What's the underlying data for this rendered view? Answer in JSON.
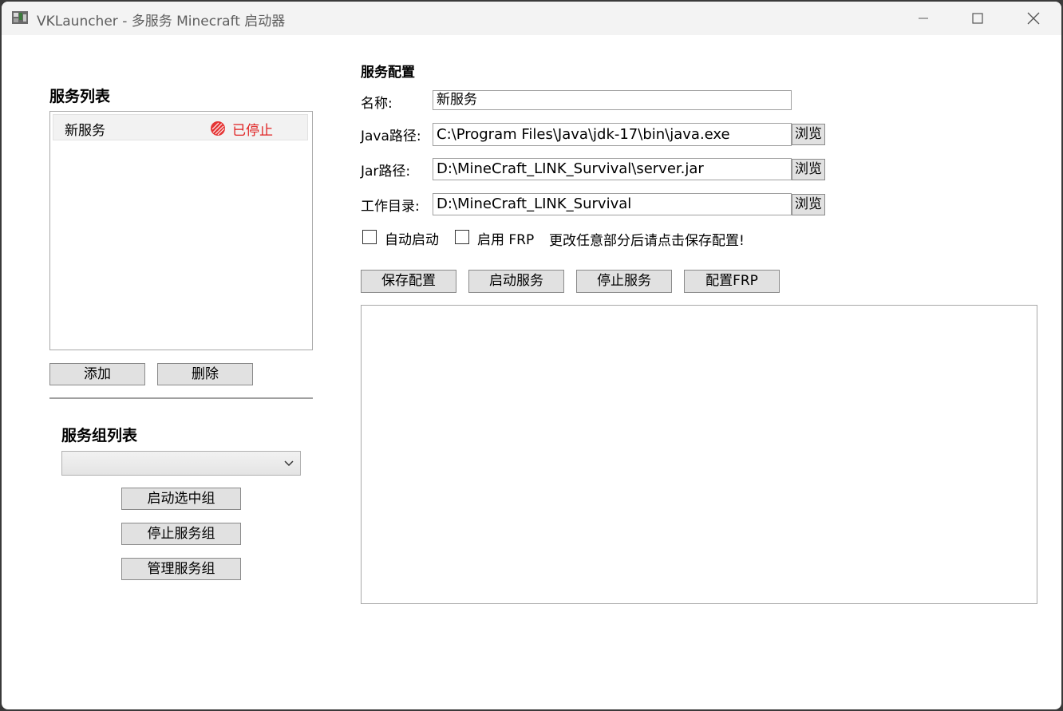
{
  "window": {
    "title": "VKLauncher - 多服务 Minecraft 启动器"
  },
  "service_list": {
    "heading": "服务列表",
    "items": [
      {
        "name": "新服务",
        "status": "已停止",
        "status_color": "#e02020"
      }
    ],
    "add_label": "添加",
    "delete_label": "删除"
  },
  "group_list": {
    "heading": "服务组列表",
    "selected": "",
    "start_label": "启动选中组",
    "stop_label": "停止服务组",
    "manage_label": "管理服务组"
  },
  "config": {
    "heading": "服务配置",
    "name_label": "名称:",
    "name_value": "新服务",
    "java_label": "Java路径:",
    "java_value": "C:\\Program Files\\Java\\jdk-17\\bin\\java.exe",
    "jar_label": "Jar路径:",
    "jar_value": "D:\\MineCraft_LINK_Survival\\server.jar",
    "workdir_label": "工作目录:",
    "workdir_value": "D:\\MineCraft_LINK_Survival",
    "browse_label": "浏览",
    "autostart_label": "自动启动",
    "frp_label": "启用 FRP",
    "notice": "更改任意部分后请点击保存配置!"
  },
  "actions": {
    "save_label": "保存配置",
    "start_label": "启动服务",
    "stop_label": "停止服务",
    "frp_label": "配置FRP"
  }
}
